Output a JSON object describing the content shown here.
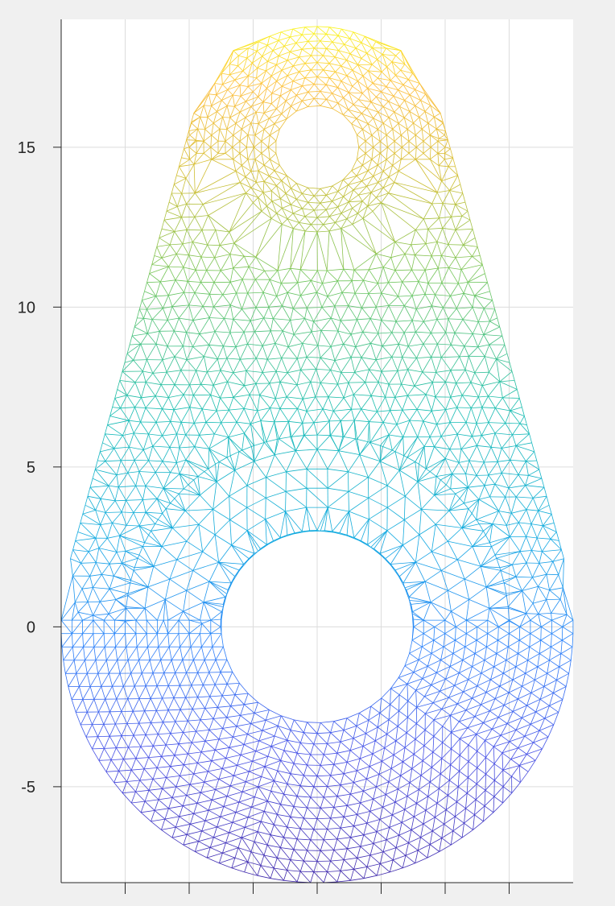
{
  "chart_data": {
    "type": "mesh",
    "title": "",
    "xlabel": "",
    "ylabel": "",
    "xlim": [
      -8,
      8
    ],
    "ylim": [
      -8,
      19
    ],
    "grid": true,
    "colormap": "parula",
    "color_by": "y",
    "yticks": [
      {
        "value": 15,
        "label": "15"
      },
      {
        "value": 10,
        "label": "10"
      },
      {
        "value": 5,
        "label": "5"
      },
      {
        "value": 0,
        "label": "0"
      },
      {
        "value": -5,
        "label": "-5"
      }
    ],
    "xticks": [
      {
        "value": -6,
        "label": ""
      },
      {
        "value": -4,
        "label": ""
      },
      {
        "value": -2,
        "label": ""
      },
      {
        "value": 0,
        "label": ""
      },
      {
        "value": 2,
        "label": ""
      },
      {
        "value": 4,
        "label": ""
      },
      {
        "value": 6,
        "label": ""
      }
    ],
    "geometry": {
      "outer_arc": {
        "center": [
          0,
          0
        ],
        "radius": 8
      },
      "top_arc": {
        "center": [
          0,
          15
        ],
        "radius": 4
      },
      "top_hole": {
        "center": [
          0,
          15
        ],
        "radius": 1.3
      },
      "main_hole": {
        "center": [
          0,
          0
        ],
        "radius": 3
      },
      "inner_half_annulus": {
        "center": [
          0,
          0
        ],
        "inner_radius": 3,
        "outer_radius": 6,
        "edge_y": 0.15
      }
    }
  }
}
